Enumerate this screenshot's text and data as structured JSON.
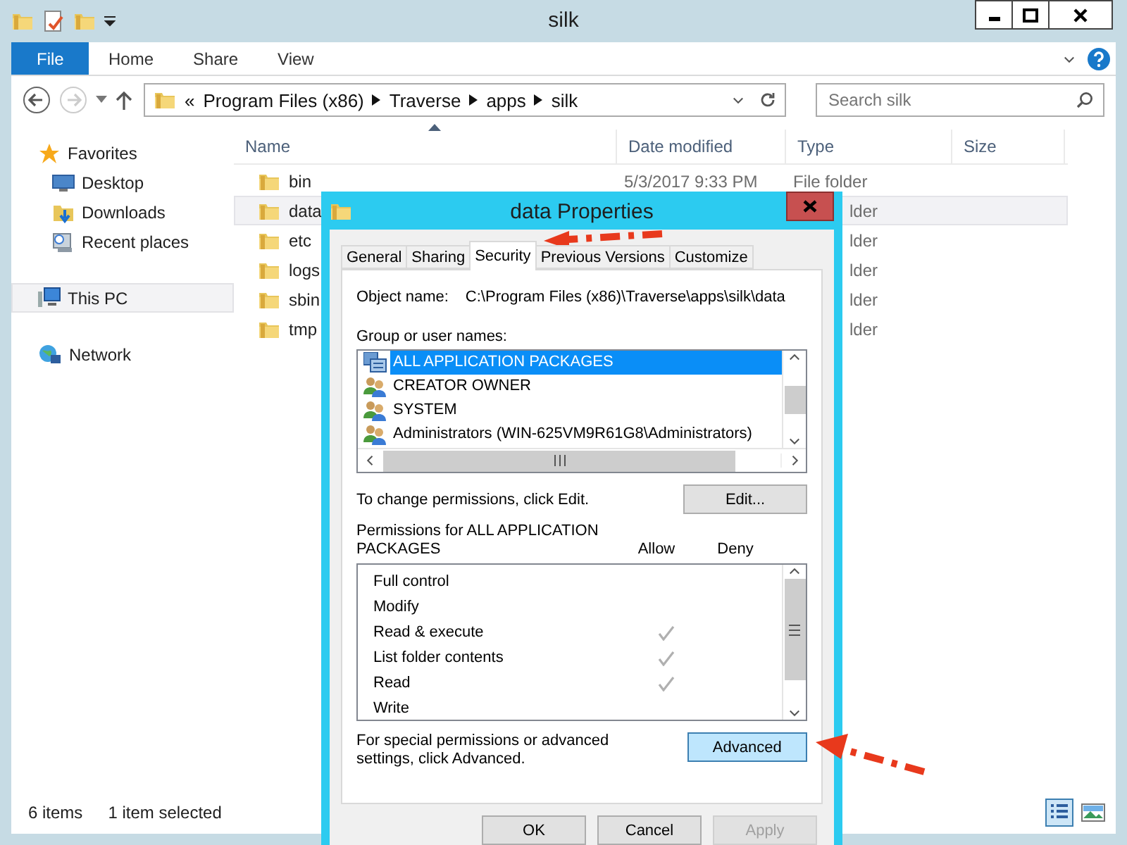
{
  "explorer": {
    "title": "silk",
    "ribbon_tabs": [
      {
        "label": "File",
        "kind": "file"
      },
      {
        "label": "Home",
        "kind": "tab"
      },
      {
        "label": "Share",
        "kind": "tab"
      },
      {
        "label": "View",
        "kind": "tab"
      }
    ],
    "address": {
      "prefix": "«",
      "crumbs": [
        "Program Files (x86)",
        "Traverse",
        "apps",
        "silk"
      ]
    },
    "search": {
      "placeholder": "Search silk"
    },
    "nav": [
      {
        "label": "Favorites",
        "kind": "star",
        "selected": false,
        "children": [
          {
            "label": "Desktop",
            "kind": "desktop",
            "selected": false
          },
          {
            "label": "Downloads",
            "kind": "downloads",
            "selected": false
          },
          {
            "label": "Recent places",
            "kind": "recent",
            "selected": false
          }
        ]
      },
      {
        "label": "This PC",
        "kind": "pc",
        "selected": true
      },
      {
        "label": "Network",
        "kind": "network",
        "selected": false
      }
    ],
    "columns": [
      "Name",
      "Date modified",
      "Type",
      "Size"
    ],
    "files": [
      {
        "name": "bin",
        "date": "5/3/2017 9:33 PM",
        "type": "File folder",
        "selected": false,
        "covered": false
      },
      {
        "name": "data",
        "type": "lder",
        "selected": true,
        "covered": true
      },
      {
        "name": "etc",
        "type": "lder",
        "selected": false,
        "covered": true
      },
      {
        "name": "logs",
        "type": "lder",
        "selected": false,
        "covered": true
      },
      {
        "name": "sbin",
        "type": "lder",
        "selected": false,
        "covered": true
      },
      {
        "name": "tmp",
        "type": "lder",
        "selected": false,
        "covered": true
      }
    ],
    "status": {
      "count": "6 items",
      "selection": "1 item selected"
    }
  },
  "dialog": {
    "title": "data Properties",
    "tabs": [
      {
        "label": "General",
        "selected": false
      },
      {
        "label": "Sharing",
        "selected": false
      },
      {
        "label": "Security",
        "selected": true
      },
      {
        "label": "Previous Versions",
        "selected": false
      },
      {
        "label": "Customize",
        "selected": false
      }
    ],
    "object_label": "Object name:",
    "object_name": "C:\\Program Files (x86)\\Traverse\\apps\\silk\\data",
    "group_label": "Group or user names:",
    "groups": [
      {
        "name": "ALL APPLICATION PACKAGES",
        "kind": "package",
        "selected": true
      },
      {
        "name": "CREATOR OWNER",
        "kind": "users",
        "selected": false
      },
      {
        "name": "SYSTEM",
        "kind": "users",
        "selected": false
      },
      {
        "name": "Administrators (WIN-625VM9R61G8\\Administrators)",
        "kind": "users",
        "selected": false
      }
    ],
    "edit_hint": "To change permissions, click Edit.",
    "edit_button": "Edit...",
    "perm_label": "Permissions for ALL APPLICATION PACKAGES",
    "allow_label": "Allow",
    "deny_label": "Deny",
    "permissions": [
      {
        "name": "Full control",
        "allow": false,
        "deny": false
      },
      {
        "name": "Modify",
        "allow": false,
        "deny": false
      },
      {
        "name": "Read & execute",
        "allow": true,
        "deny": false
      },
      {
        "name": "List folder contents",
        "allow": true,
        "deny": false
      },
      {
        "name": "Read",
        "allow": true,
        "deny": false
      },
      {
        "name": "Write",
        "allow": false,
        "deny": false
      }
    ],
    "advanced_hint": "For special permissions or advanced settings, click Advanced.",
    "advanced_button": "Advanced",
    "buttons": [
      {
        "label": "OK",
        "disabled": false
      },
      {
        "label": "Cancel",
        "disabled": false
      },
      {
        "label": "Apply",
        "disabled": true
      }
    ]
  }
}
